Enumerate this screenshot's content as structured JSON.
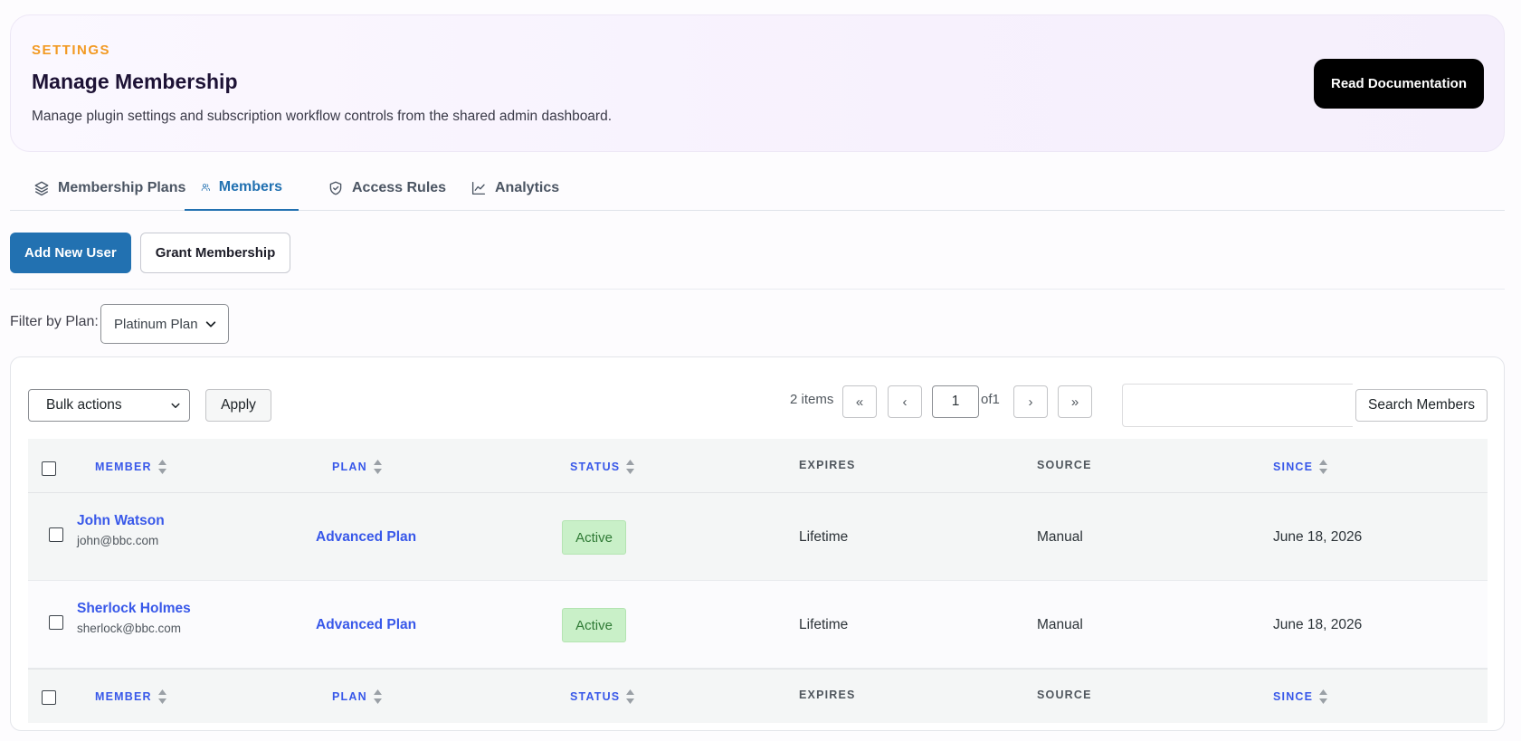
{
  "header": {
    "eyebrow": "SETTINGS",
    "title": "Manage Membership",
    "subtitle": "Manage plugin settings and subscription workflow controls from the shared admin dashboard.",
    "doc_button": "Read Documentation"
  },
  "tabs": [
    {
      "label": "Membership Plans",
      "icon": "layers-icon",
      "active": false
    },
    {
      "label": "Members",
      "icon": "users-icon",
      "active": true
    },
    {
      "label": "Access Rules",
      "icon": "shield-icon",
      "active": false
    },
    {
      "label": "Analytics",
      "icon": "chart-line-icon",
      "active": false
    }
  ],
  "actions": {
    "add_user": "Add New User",
    "grant": "Grant Membership"
  },
  "filter": {
    "label": "Filter by Plan:",
    "selected": "Platinum Plan"
  },
  "toolbar": {
    "bulk_selected": "Bulk actions",
    "apply": "Apply",
    "items_count": "2 items",
    "first": "«",
    "prev": "‹",
    "current_page": "1",
    "of_pages": "of1",
    "next": "›",
    "last": "»",
    "search_placeholder": "",
    "search_button": "Search Members"
  },
  "table": {
    "columns": {
      "member": "MEMBER",
      "plan": "PLAN",
      "status": "STATUS",
      "expires": "EXPIRES",
      "source": "SOURCE",
      "since": "SINCE"
    },
    "rows": [
      {
        "name": "John Watson",
        "email": "john@bbc.com",
        "plan": "Advanced Plan",
        "status": "Active",
        "expires": "Lifetime",
        "source": "Manual",
        "since": "June 18, 2026"
      },
      {
        "name": "Sherlock Holmes",
        "email": "sherlock@bbc.com",
        "plan": "Advanced Plan",
        "status": "Active",
        "expires": "Lifetime",
        "source": "Manual",
        "since": "June 18, 2026"
      }
    ]
  },
  "colors": {
    "accent": "#2271b1",
    "link": "#3858e9",
    "eyebrow": "#f29a23",
    "status_active_bg": "#c9f0c8"
  }
}
